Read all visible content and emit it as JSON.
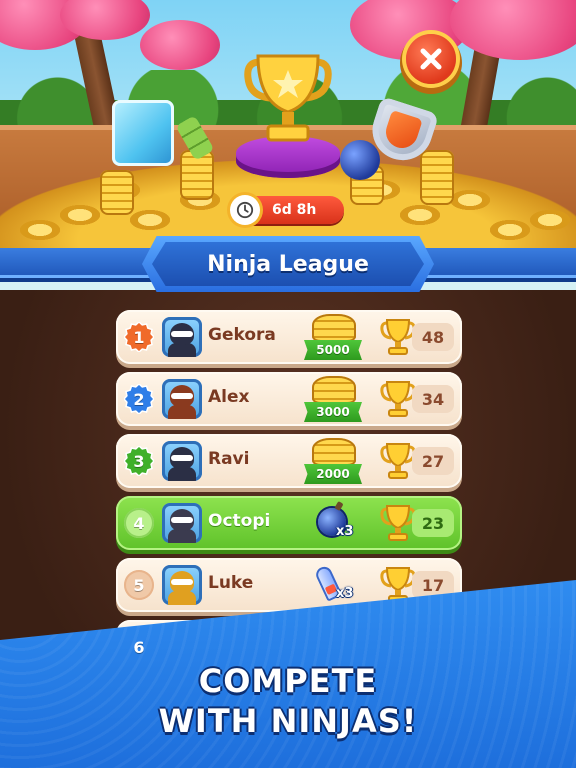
{
  "league": {
    "title": "Ninja League",
    "time_left": "6d 8h"
  },
  "leaderboard": [
    {
      "rank": "1",
      "name": "Gekora",
      "reward": "5000",
      "reward_type": "coins",
      "score": "48",
      "avatar_color": "#2b2f45"
    },
    {
      "rank": "2",
      "name": "Alex",
      "reward": "3000",
      "reward_type": "coins",
      "score": "34",
      "avatar_color": "#8a3a1f"
    },
    {
      "rank": "3",
      "name": "Ravi",
      "reward": "2000",
      "reward_type": "coins",
      "score": "27",
      "avatar_color": "#2b2f45"
    },
    {
      "rank": "4",
      "name": "Octopi",
      "reward": "x3",
      "reward_type": "bomb",
      "score": "23",
      "avatar_color": "#3b3b4f",
      "is_current_player": true
    },
    {
      "rank": "5",
      "name": "Luke",
      "reward": "x3",
      "reward_type": "rocket",
      "score": "17",
      "avatar_color": "#e0a020"
    },
    {
      "rank": "6",
      "name": "",
      "reward": "",
      "reward_type": "",
      "score": "",
      "avatar_color": "#3b3b4f"
    }
  ],
  "promo": {
    "line1": "COMPETE",
    "line2": "WITH NINJAS!"
  },
  "colors": {
    "rank1": "#f06a2a",
    "rank2": "#2f7ee8",
    "rank3": "#3fb02a",
    "highlight_row": "#6fd23a",
    "banner_blue": "#2f72d8"
  }
}
